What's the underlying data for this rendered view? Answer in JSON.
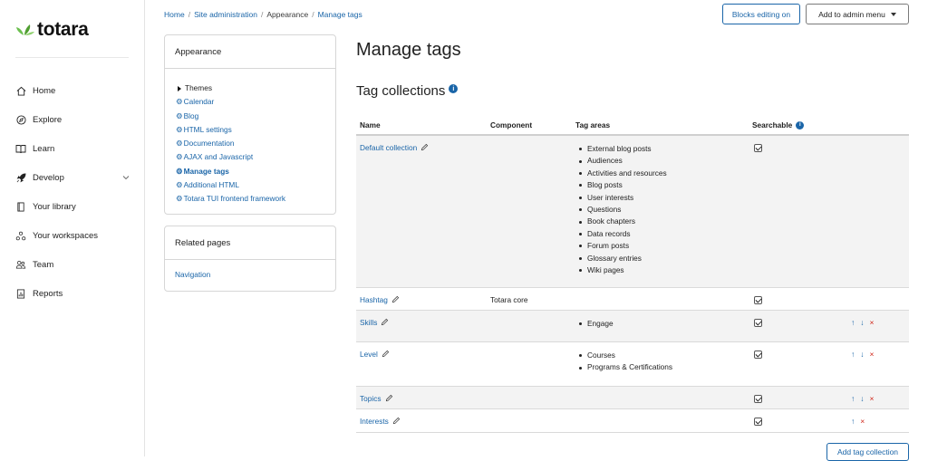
{
  "brand": {
    "logo_text": "totara",
    "logo_icon": "totara-leaf-icon",
    "leaf_colors": [
      "#6bbf4e",
      "#4f9e2f",
      "#8fd16f"
    ]
  },
  "sidebar": {
    "items": [
      {
        "label": "Home",
        "icon": "home-icon"
      },
      {
        "label": "Explore",
        "icon": "compass-icon"
      },
      {
        "label": "Learn",
        "icon": "book-icon"
      },
      {
        "label": "Develop",
        "icon": "rocket-icon",
        "expandable": true
      },
      {
        "label": "Your library",
        "icon": "library-icon"
      },
      {
        "label": "Your workspaces",
        "icon": "workspaces-icon"
      },
      {
        "label": "Team",
        "icon": "team-icon"
      },
      {
        "label": "Reports",
        "icon": "reports-icon"
      }
    ]
  },
  "breadcrumb": {
    "home": "Home",
    "site_admin": "Site administration",
    "appearance": "Appearance",
    "current": "Manage tags"
  },
  "header_buttons": {
    "blocks_editing": "Blocks editing on",
    "add_admin_menu": "Add to admin menu"
  },
  "appearance_block": {
    "title": "Appearance",
    "themes": "Themes",
    "links": [
      "Calendar",
      "Blog",
      "HTML settings",
      "Documentation",
      "AJAX and Javascript",
      "Manage tags",
      "Additional HTML",
      "Totara TUI frontend framework"
    ],
    "active": "Manage tags"
  },
  "related_block": {
    "title": "Related pages",
    "link": "Navigation"
  },
  "page": {
    "title": "Manage tags",
    "subtitle": "Tag collections"
  },
  "table": {
    "headers": {
      "name": "Name",
      "component": "Component",
      "tag_areas": "Tag areas",
      "searchable": "Searchable"
    },
    "rows": [
      {
        "name": "Default collection",
        "component": "",
        "areas": [
          "External blog posts",
          "Audiences",
          "Activities and resources",
          "Blog posts",
          "User interests",
          "Questions",
          "Book chapters",
          "Data records",
          "Forum posts",
          "Glossary entries",
          "Wiki pages"
        ],
        "searchable": true,
        "actions": []
      },
      {
        "name": "Hashtag",
        "component": "Totara core",
        "areas": [],
        "searchable": true,
        "actions": []
      },
      {
        "name": "Skills",
        "component": "",
        "areas": [
          "Engage"
        ],
        "searchable": true,
        "actions": [
          "↑",
          "↓",
          "×"
        ]
      },
      {
        "name": "Level",
        "component": "",
        "areas": [
          "Courses",
          "Programs & Certifications"
        ],
        "searchable": true,
        "actions": [
          "↑",
          "↓",
          "×"
        ]
      },
      {
        "name": "Topics",
        "component": "",
        "areas": [],
        "searchable": true,
        "actions": [
          "↑",
          "↓",
          "×"
        ]
      },
      {
        "name": "Interests",
        "component": "",
        "areas": [],
        "searchable": true,
        "actions": [
          "↑",
          "×"
        ]
      }
    ]
  },
  "add_button": "Add tag collection",
  "colors": {
    "link": "#1a65a8",
    "delete": "#d0261a",
    "shaded_row": "#f3f3f3"
  }
}
